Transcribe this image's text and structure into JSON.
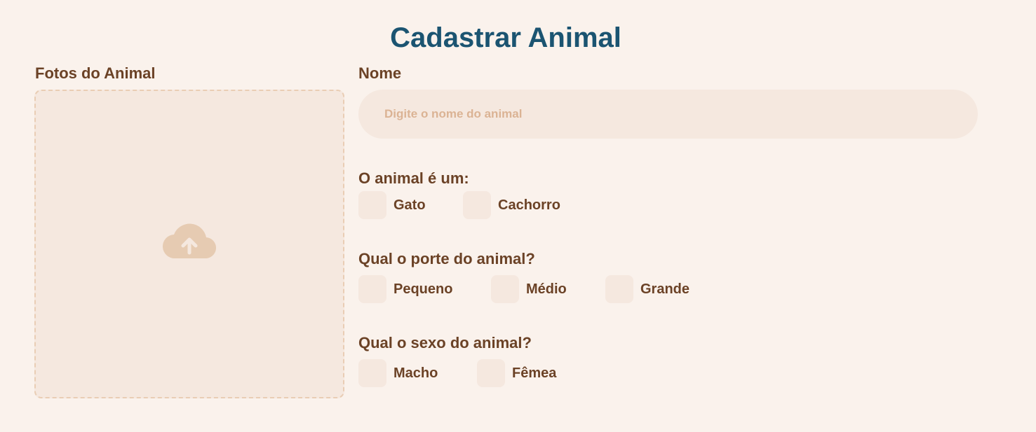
{
  "page": {
    "title": "Cadastrar Animal"
  },
  "photos": {
    "label": "Fotos do Animal",
    "icon": "cloud-upload-icon"
  },
  "name": {
    "label": "Nome",
    "placeholder": "Digite o nome do animal",
    "value": ""
  },
  "species": {
    "label": "O animal é um:",
    "options": [
      "Gato",
      "Cachorro"
    ]
  },
  "size": {
    "label": "Qual o porte do animal?",
    "options": [
      "Pequeno",
      "Médio",
      "Grande"
    ]
  },
  "sex": {
    "label": "Qual o sexo do animal?",
    "options": [
      "Macho",
      "Fêmea"
    ]
  },
  "colors": {
    "background": "#FAF2EC",
    "title": "#1B5471",
    "label": "#6B4226",
    "field": "#F5E8DF",
    "placeholder": "#DBB394",
    "upload_border": "#E9CDB4",
    "upload_icon": "#E6CBB2"
  }
}
